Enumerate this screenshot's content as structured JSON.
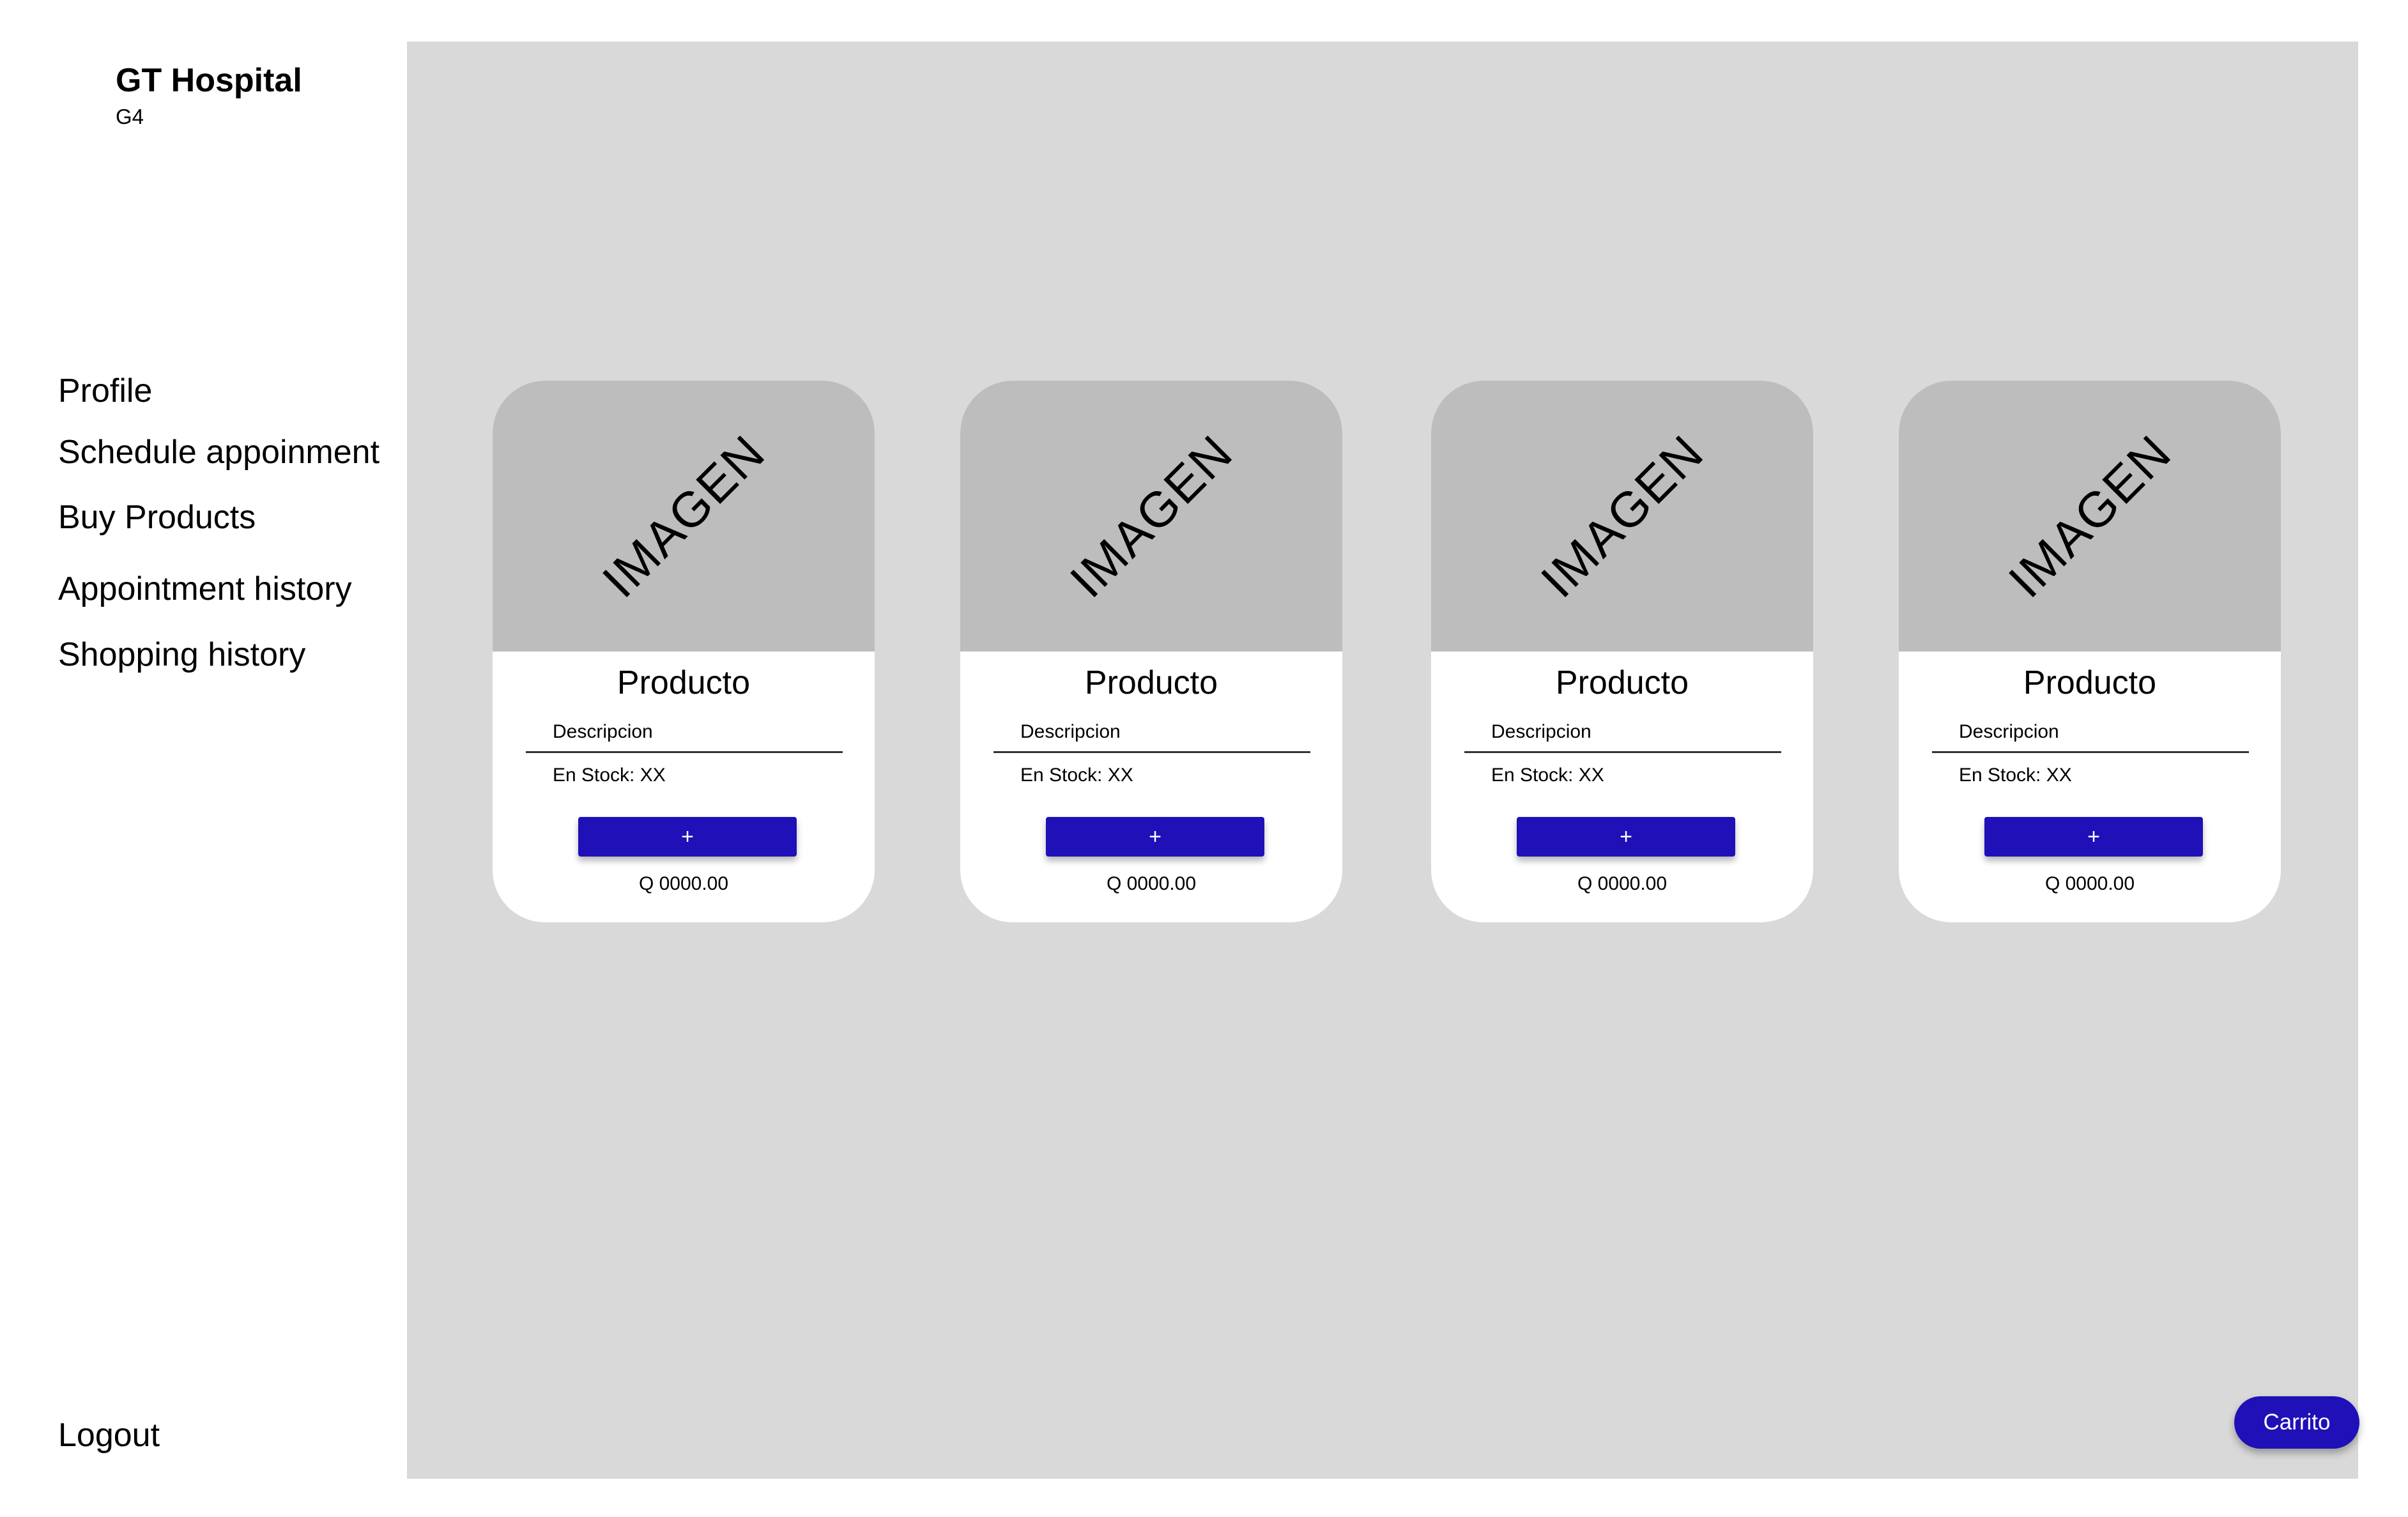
{
  "app": {
    "title": "GT Hospital",
    "subtitle": "G4"
  },
  "sidebar": {
    "items": [
      {
        "label": "Profile"
      },
      {
        "label": "Schedule appoinment"
      },
      {
        "label": "Buy Products"
      },
      {
        "label": "Appointment history"
      },
      {
        "label": "Shopping history"
      }
    ],
    "logout_label": "Logout"
  },
  "products": [
    {
      "image_label": "IMAGEN",
      "name": "Producto",
      "description": "Descripcion",
      "stock": "En Stock: XX",
      "add_label": "+",
      "price": "Q 0000.00"
    },
    {
      "image_label": "IMAGEN",
      "name": "Producto",
      "description": "Descripcion",
      "stock": "En Stock: XX",
      "add_label": "+",
      "price": "Q 0000.00"
    },
    {
      "image_label": "IMAGEN",
      "name": "Producto",
      "description": "Descripcion",
      "stock": "En Stock: XX",
      "add_label": "+",
      "price": "Q 0000.00"
    },
    {
      "image_label": "IMAGEN",
      "name": "Producto",
      "description": "Descripcion",
      "stock": "En Stock: XX",
      "add_label": "+",
      "price": "Q 0000.00"
    }
  ],
  "cart": {
    "label": "Carrito"
  },
  "colors": {
    "accent": "#1f10b8",
    "main_background": "#d9d9d9",
    "image_placeholder": "#bdbdbd",
    "sidebar_background": "#ffffff"
  }
}
